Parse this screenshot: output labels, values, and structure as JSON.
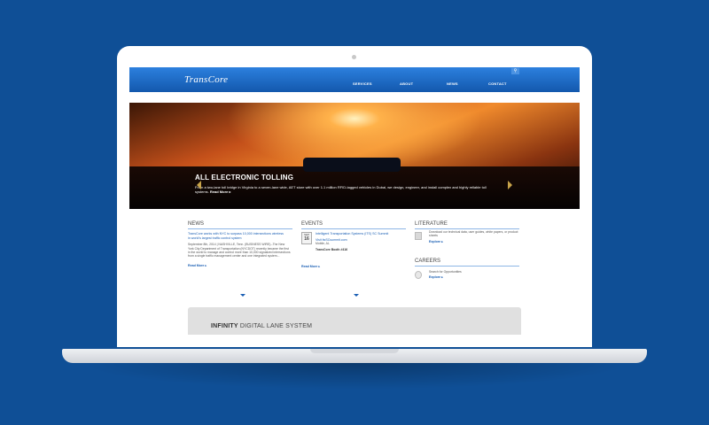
{
  "site": {
    "logo": "TransCore",
    "nav": [
      "SERVICES",
      "ABOUT",
      "NEWS",
      "CONTACT"
    ],
    "search_icon": "search-icon"
  },
  "hero": {
    "title": "ALL ELECTRONIC TOLLING",
    "text": "From a two-lane toll bridge in Virginia to a seven-lane wide, AET store with over 1.1 million RFID-tagged vehicles in Dubai, we design, engineer, and install complex and highly reliable toll systems.",
    "more": "Read More ▸"
  },
  "news": {
    "heading": "NEWS",
    "headline": "TransCore works with NYC to surpass 10,000 intersections wireless in world's largest traffic control system",
    "body": "September 8th, 2014 | NASHVILLE, Tenn. (BUSINESS WIRE)--The New York City Department of Transportation (NYCDOT) recently became the first in the world to manage and control more than 10,000 signalized intersections from a single traffic management center and one integrated system...",
    "read_more": "Read More ▸"
  },
  "events": {
    "heading": "EVENTS",
    "month": "SEP",
    "day": "16",
    "title": "Intelligent Transportation Systems (ITS) SC Summit",
    "link": "Visit itsSCsummit.com",
    "location": "Mobile, AL",
    "booth": "TransCore Booth #416",
    "read_more": "Read More ▸"
  },
  "literature": {
    "heading": "LITERATURE",
    "text": "Download our technical data, user guides, white papers, or product sheets",
    "explore": "Explore ▸"
  },
  "careers": {
    "heading": "CAREERS",
    "text": "Search for Opportunities",
    "explore": "Explore ▸"
  },
  "infinity": {
    "bold": "INFINITY",
    "rest": " DIGITAL LANE SYSTEM"
  },
  "colors": {
    "background": "#0f4f96",
    "header": "#1a64c0",
    "link": "#1a5fb4"
  }
}
